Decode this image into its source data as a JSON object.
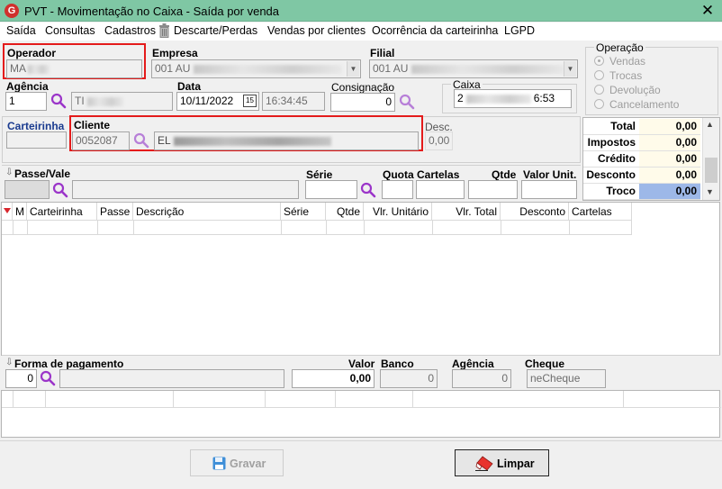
{
  "window": {
    "title": "PVT - Movimentação no Caixa - Saída por venda",
    "close_glyph": "✕",
    "app_icon": "G"
  },
  "menu": {
    "items": [
      "Saída",
      "Consultas",
      "Cadastros",
      "Descarte/Perdas",
      "Vendas por clientes",
      "Ocorrência da carteirinha",
      "LGPD"
    ]
  },
  "operador": {
    "label": "Operador",
    "value": "MA"
  },
  "empresa": {
    "label": "Empresa",
    "value": "001 AU"
  },
  "filial": {
    "label": "Filial",
    "value": "001 AU"
  },
  "agencia": {
    "label": "Agência",
    "value": "1",
    "name": "TI"
  },
  "data": {
    "label": "Data",
    "date": "10/11/2022",
    "calendar": "15",
    "time": "16:34:45"
  },
  "consignacao": {
    "label": "Consignação",
    "value": "0"
  },
  "caixa": {
    "label": "Caixa",
    "value_prefix": "2",
    "value_suffix": "6:53"
  },
  "operacao": {
    "label": "Operação",
    "options": [
      {
        "label": "Vendas",
        "selected": true
      },
      {
        "label": "Trocas",
        "selected": false
      },
      {
        "label": "Devolução",
        "selected": false
      },
      {
        "label": "Cancelamento",
        "selected": false
      }
    ]
  },
  "carteirinha": {
    "label": "Carteirinha"
  },
  "cliente": {
    "label": "Cliente",
    "code": "0052087",
    "name": "EL"
  },
  "desc": {
    "label": "Desc.",
    "value": "0,00"
  },
  "totals": [
    {
      "label": "Total",
      "value": "0,00"
    },
    {
      "label": "Impostos",
      "value": "0,00"
    },
    {
      "label": "Crédito",
      "value": "0,00"
    },
    {
      "label": "Desconto",
      "value": "0,00"
    },
    {
      "label": "Troco",
      "value": "0,00"
    }
  ],
  "passe": {
    "label": "Passe/Vale",
    "serie": "Série",
    "quota": "Quota",
    "cartelas": "Cartelas",
    "qtde": "Qtde",
    "valor_unit": "Valor Unit."
  },
  "items_table": {
    "columns": [
      "M",
      "Carteirinha",
      "Passe",
      "Descrição",
      "Série",
      "Qtde",
      "Vlr. Unitário",
      "Vlr. Total",
      "Desconto",
      "Cartelas"
    ]
  },
  "pagamento": {
    "label": "Forma de pagamento",
    "code": "0",
    "valor_label": "Valor",
    "valor": "0,00",
    "banco_label": "Banco",
    "banco": "0",
    "agencia_label": "Agência",
    "agencia": "0",
    "cheque_label": "Cheque",
    "cheque": "neCheque"
  },
  "buttons": {
    "gravar": "Gravar",
    "limpar": "Limpar"
  },
  "colors": {
    "titlebar": "#7fc7a4",
    "highlight": "#e41b1b",
    "troco": "#9db8e8",
    "search": "#9b35c9"
  }
}
